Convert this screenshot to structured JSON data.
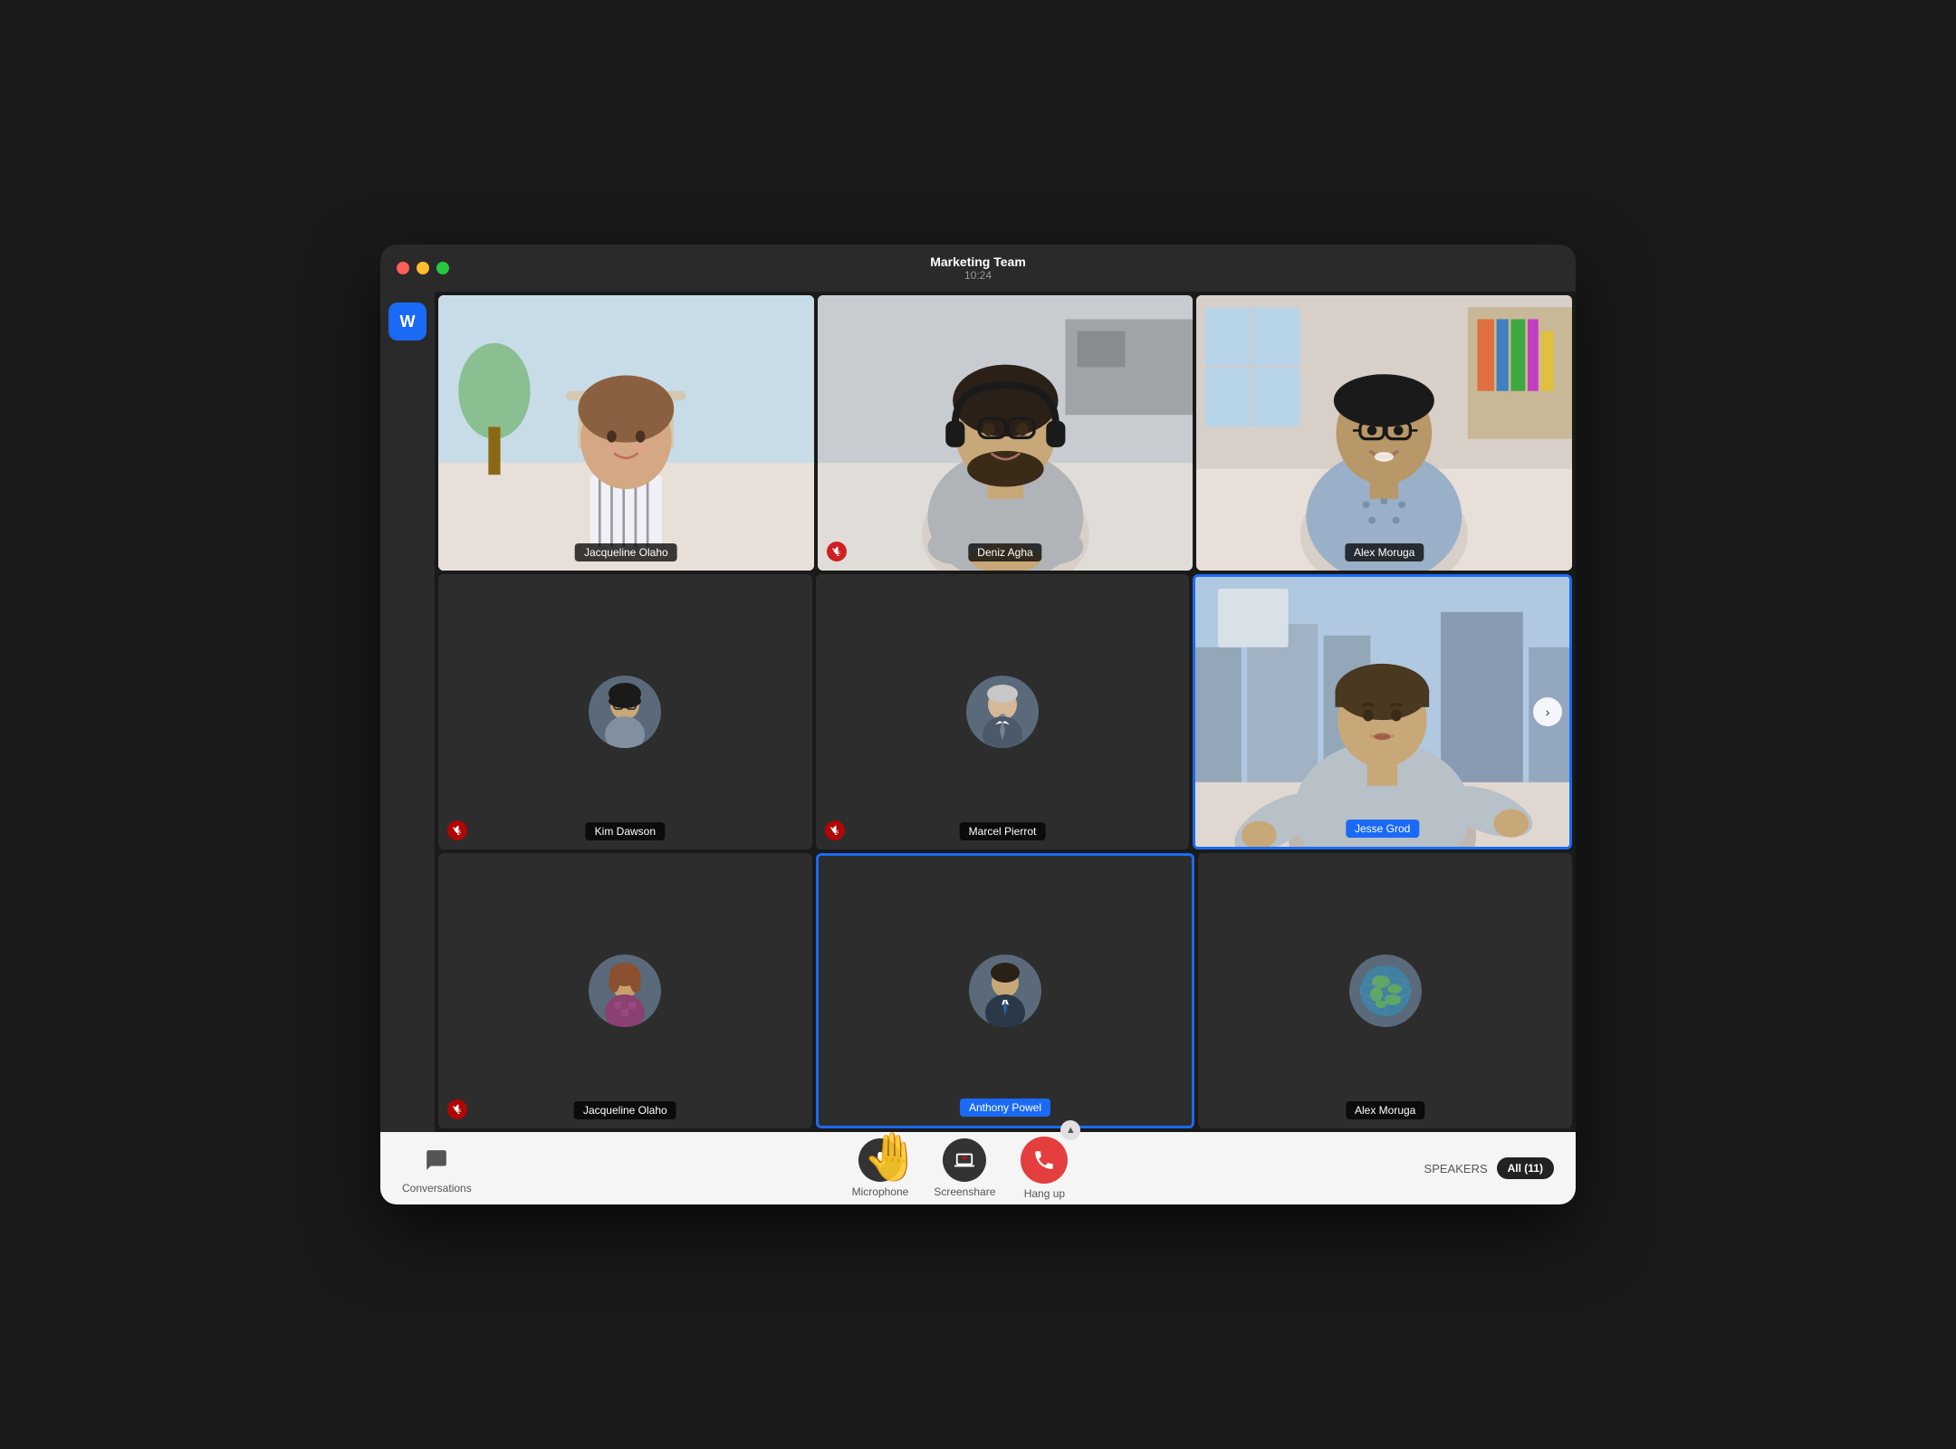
{
  "window": {
    "title": "Marketing Team",
    "subtitle": "10:24"
  },
  "sidebar": {
    "app_icon": "W"
  },
  "participants": [
    {
      "id": "jacqueline1",
      "name": "Jacqueline Olaho",
      "has_video": true,
      "muted": false,
      "active": false,
      "avatar_type": "photo"
    },
    {
      "id": "deniz",
      "name": "Deniz Agha",
      "has_video": true,
      "muted": true,
      "active": false,
      "avatar_type": "photo"
    },
    {
      "id": "alex1",
      "name": "Alex Moruga",
      "has_video": true,
      "muted": false,
      "active": false,
      "avatar_type": "photo"
    },
    {
      "id": "kim",
      "name": "Kim Dawson",
      "has_video": false,
      "muted": true,
      "active": false,
      "avatar_type": "circle"
    },
    {
      "id": "marcel",
      "name": "Marcel Pierrot",
      "has_video": false,
      "muted": true,
      "active": false,
      "avatar_type": "circle"
    },
    {
      "id": "jesse",
      "name": "Jesse Grod",
      "has_video": true,
      "muted": false,
      "active": true,
      "avatar_type": "photo"
    },
    {
      "id": "jacqueline2",
      "name": "Jacqueline Olaho",
      "has_video": false,
      "muted": true,
      "active": false,
      "avatar_type": "circle"
    },
    {
      "id": "anthony",
      "name": "Anthony Powel",
      "has_video": false,
      "muted": false,
      "active": true,
      "avatar_type": "circle"
    },
    {
      "id": "alex2",
      "name": "Alex Moruga",
      "has_video": false,
      "muted": false,
      "active": false,
      "avatar_type": "globe"
    }
  ],
  "controls": {
    "conversations_label": "Conversations",
    "microphone_label": "Microphone",
    "screenshare_label": "Screenshare",
    "hangup_label": "Hang up",
    "speakers_label": "SPEAKERS",
    "all_count": "All (11)"
  }
}
